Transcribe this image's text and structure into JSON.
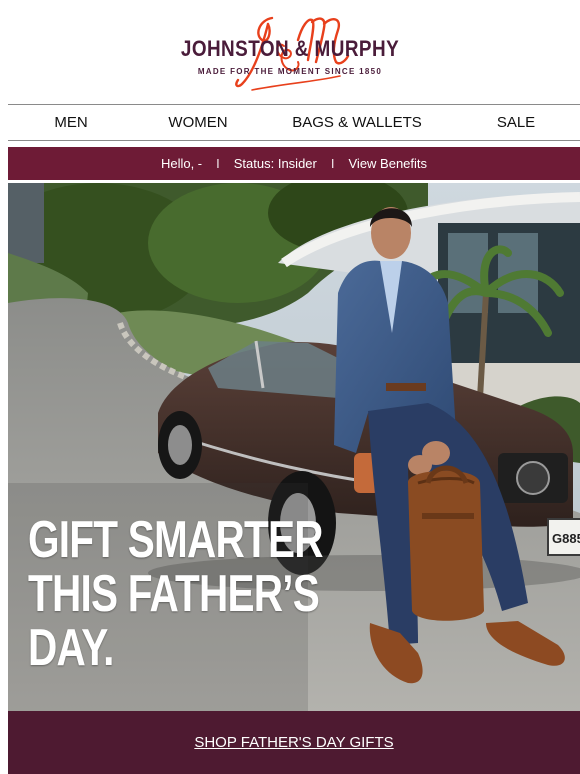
{
  "brand": {
    "name": "JOHNSTON & MURPHY",
    "tagline": "MADE FOR THE MOMENT SINCE 1850",
    "monogram": "J&M",
    "monogram_color": "#e8401c",
    "wordmark_color": "#4a1c3a"
  },
  "nav": {
    "items": [
      {
        "label": "MEN"
      },
      {
        "label": "WOMEN"
      },
      {
        "label": "BAGS & WALLETS"
      },
      {
        "label": "SALE"
      }
    ]
  },
  "status_bar": {
    "greeting": "Hello, -",
    "separator": "I",
    "status": "Status: Insider",
    "benefits_link": "View Benefits",
    "background": "#6e1b36"
  },
  "hero": {
    "headline_lines": [
      "GIFT SMARTER",
      "THIS FATHER’S",
      "DAY."
    ],
    "license_plate_fragment": "G885"
  },
  "cta": {
    "label": "SHOP FATHER'S DAY GIFTS",
    "background": "#4e1a31"
  }
}
